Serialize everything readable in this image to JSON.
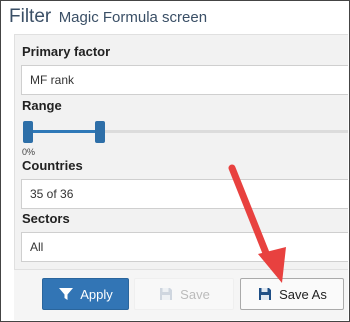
{
  "header": {
    "title": "Filter",
    "subtitle": "Magic Formula screen"
  },
  "primary_factor": {
    "label": "Primary factor",
    "value": "MF rank"
  },
  "range": {
    "label": "Range",
    "min_label": "0%"
  },
  "countries": {
    "label": "Countries",
    "value": "35 of 36"
  },
  "sectors": {
    "label": "Sectors",
    "value": "All"
  },
  "buttons": {
    "apply": "Apply",
    "save": "Save",
    "save_as": "Save As"
  },
  "colors": {
    "primary": "#3275b5",
    "annotation_arrow": "#e8413f"
  }
}
